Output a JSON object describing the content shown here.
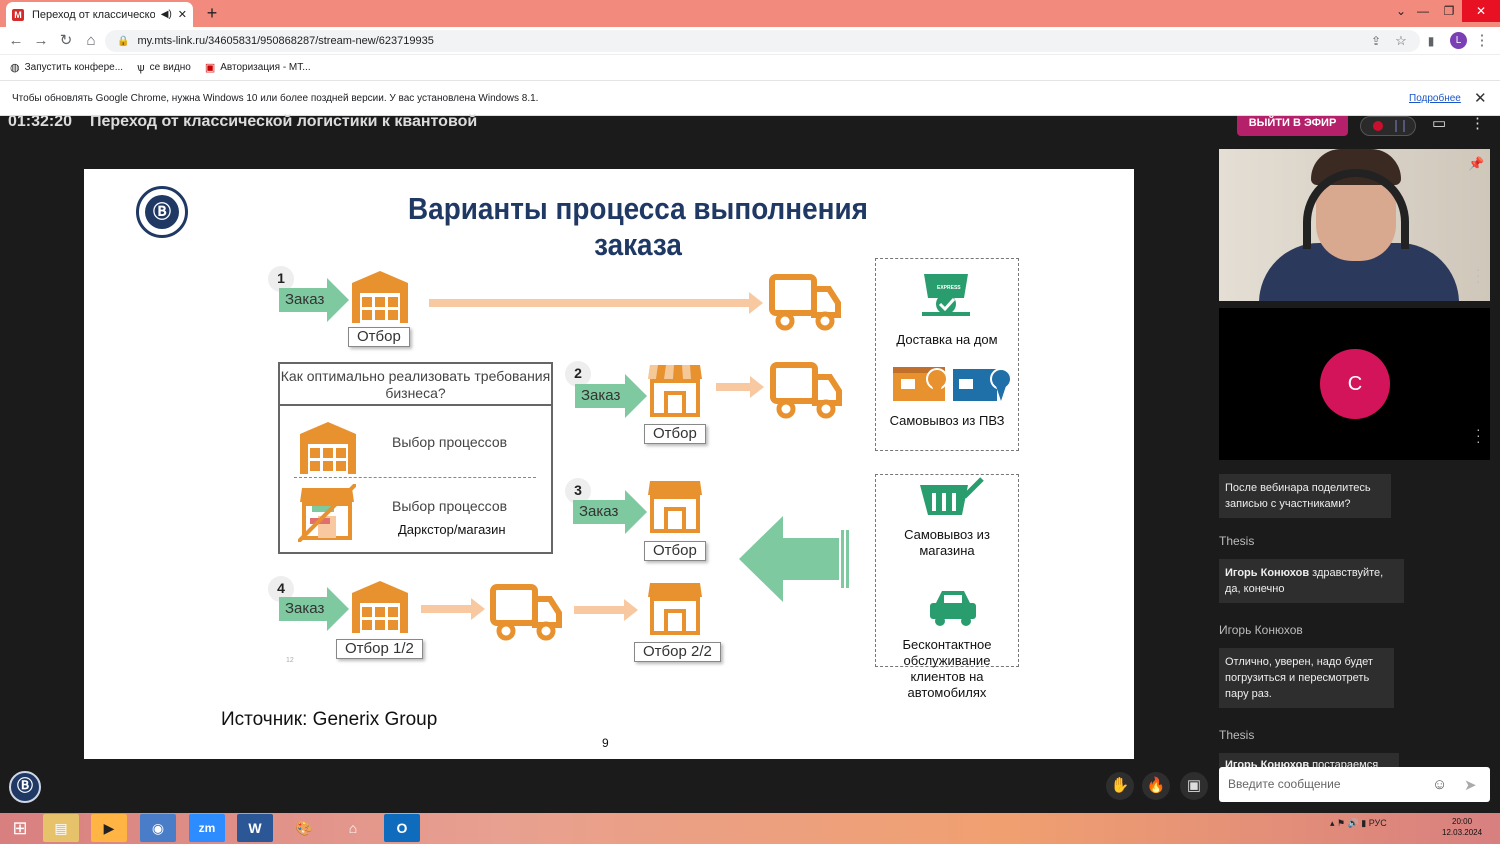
{
  "browser": {
    "tab_title": "Переход от классической л",
    "tab_favicon": "М",
    "new_tab": "+",
    "url": "my.mts-link.ru/34605831/950868287/stream-new/623719935",
    "profile_letter": "L",
    "bookmarks": [
      "Запустить конфере...",
      "се видно",
      "Авторизация - МТ..."
    ],
    "infobar_text": "Чтобы обновлять Google Chrome, нужна Windows 10 или более поздней версии. У вас установлена Windows 8.1.",
    "infobar_link": "Подробнее"
  },
  "webinar": {
    "timer": "01:32:20",
    "title": "Переход от классической логистики к квантовой",
    "air_button": "ВЫЙТИ В ЭФИР"
  },
  "slide": {
    "title": "Варианты процесса выполнения заказа",
    "order_label": "Заказ",
    "pick_label": "Отбор",
    "pick_half1": "Отбор 1/2",
    "pick_half2": "Отбор 2/2",
    "numbers": [
      "1",
      "2",
      "3",
      "4"
    ],
    "question": "Как оптимально реализовать требования бизнеса?",
    "choice1": "Выбор процессов",
    "choice2": "Выбор процессов",
    "choice2_sub": "Даркстор/магазин",
    "services": [
      "Доставка на дом",
      "Самовывоз из ПВЗ",
      "Самовывоз из магазина",
      "Бесконтактное обслуживание клиентов на автомобилях"
    ],
    "express": "EXPRESS",
    "source": "Источник: Generix Group",
    "page": "9",
    "tiny": "12"
  },
  "participants": {
    "avatar_letter": "C"
  },
  "chat": {
    "messages": [
      {
        "author": "",
        "text": "После вебинара поделитесь записью с участниками?"
      },
      {
        "author": "Thesis",
        "bold": "Игорь Конюхов",
        "text": " здравствуйте, да, конечно"
      },
      {
        "author": "Игорь Конюхов",
        "text": "Отлично, уверен, надо будет погрузиться и пересмотреть пару раз."
      },
      {
        "author": "Thesis",
        "bold": "Игорь Конюхов",
        "text": " постараемся"
      }
    ],
    "input_placeholder": "Введите сообщение"
  },
  "taskbar": {
    "lang": "РУС",
    "time": "20:00",
    "date": "12.03.2024"
  },
  "colors": {
    "accent": "#b5206a",
    "orange": "#e8912f",
    "green": "#7ec9a0",
    "navy": "#1f3864"
  }
}
